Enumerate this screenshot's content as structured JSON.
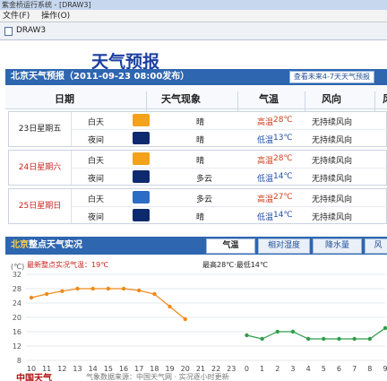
{
  "window": {
    "title": "紫金桥运行系统 - [DRAW3]"
  },
  "menu": {
    "file": "文件(F)",
    "operate": "操作(O)"
  },
  "doc_tab": "DRAW3",
  "page_title": "天气预报",
  "forecast": {
    "header": "北京天气预报（2011-09-23 08:00发布）",
    "more_button": "查看未来4-7天天气预报",
    "columns": {
      "date": "日期",
      "weather": "天气现象",
      "temp": "气温",
      "wind_dir": "风向",
      "wind_power": "风"
    },
    "days": [
      {
        "date": "23日星期五",
        "rows": [
          {
            "period": "白天",
            "icon": "sunny-icon",
            "cond": "晴",
            "temp_label": "高温",
            "temp": "28℃",
            "wind": "无持续风向"
          },
          {
            "period": "夜间",
            "icon": "moon-icon",
            "cond": "晴",
            "temp_label": "低温",
            "temp": "13℃",
            "wind": "无持续风向"
          }
        ]
      },
      {
        "date": "24日星期六",
        "rows": [
          {
            "period": "白天",
            "icon": "sunny-icon",
            "cond": "晴",
            "temp_label": "高温",
            "temp": "28℃",
            "wind": "无持续风向"
          },
          {
            "period": "夜间",
            "icon": "cloudy-night-icon",
            "cond": "多云",
            "temp_label": "低温",
            "temp": "14℃",
            "wind": "无持续风向"
          }
        ]
      },
      {
        "date": "25日星期日",
        "rows": [
          {
            "period": "白天",
            "icon": "partly-cloudy-icon",
            "cond": "多云",
            "temp_label": "高温",
            "temp": "27℃",
            "wind": "无持续风向"
          },
          {
            "period": "夜间",
            "icon": "moon-icon",
            "cond": "晴",
            "temp_label": "低温",
            "temp": "14℃",
            "wind": "无持续风向"
          }
        ]
      }
    ]
  },
  "observation": {
    "header_city": "北京",
    "header_rest": "整点天气实况",
    "tabs": [
      "气温",
      "相对湿度",
      "降水量",
      "风"
    ],
    "latest": "最新整点实况气温：19℃",
    "range": "最高28℃·最低14℃",
    "unit": "(℃)",
    "footer_logo": "中国天气",
    "footer_note": "气象数据来源：中国天气网 · 实况逐小时更新"
  },
  "colors": {
    "accent": "#2e66b0",
    "curve": "#f08a1a",
    "hot": "#d0401a",
    "cold": "#1f4fa8"
  },
  "chart_data": {
    "type": "line",
    "ylim": [
      8,
      32
    ],
    "yticks": [
      8,
      12,
      16,
      20,
      24,
      28,
      32
    ],
    "x": [
      "10",
      "11",
      "12",
      "13",
      "14",
      "15",
      "16",
      "17",
      "18",
      "19",
      "20",
      "21",
      "22",
      "23",
      "0",
      "1",
      "2",
      "3",
      "4",
      "5",
      "6",
      "7",
      "8",
      "9"
    ],
    "series": [
      {
        "values": [
          25.5,
          26.5,
          27.3,
          28,
          28,
          28,
          28,
          27.5,
          26.5,
          23,
          19.5,
          null,
          null,
          null,
          15,
          14,
          16,
          16,
          14,
          14,
          14,
          14,
          14,
          17
        ]
      }
    ]
  }
}
